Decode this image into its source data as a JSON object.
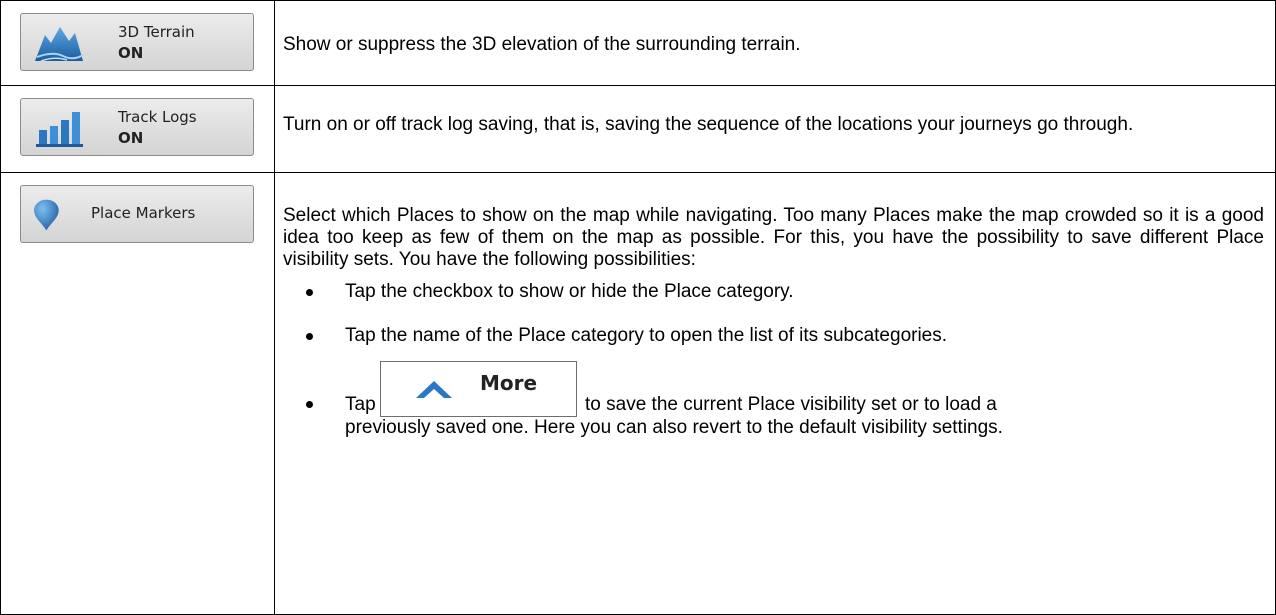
{
  "rows": [
    {
      "button": {
        "label": "3D Terrain",
        "value": "ON",
        "icon": "terrain-icon"
      },
      "description": "Show or suppress the 3D elevation of the surrounding terrain."
    },
    {
      "button": {
        "label": "Track Logs",
        "value": "ON",
        "icon": "track-logs-icon"
      },
      "description": "Turn on or off track log saving, that is, saving the sequence of the locations your journeys go through."
    },
    {
      "button": {
        "label": "Place Markers",
        "icon": "place-marker-icon"
      },
      "description": "Select which Places to show on the map while navigating. Too many Places make the map crowded so it is a good idea too keep as few of them on the map as possible. For this, you have the possibility to save different Place visibility sets. You have the following possibilities:",
      "bullets": [
        "Tap the checkbox to show or hide the Place category.",
        "Tap the name of the Place category to open the list of its subcategories."
      ],
      "more_bullet": {
        "before": "Tap",
        "button_label": "More",
        "button_icon": "chevron-up-icon",
        "after": "to save the current Place visibility set or to load a",
        "continuation": "previously saved one. Here you can also revert to the default visibility settings."
      }
    }
  ],
  "colors": {
    "icon_blue": "#2a78c4",
    "icon_dark": "#1d5a9c",
    "button_bg": "#dedede"
  }
}
